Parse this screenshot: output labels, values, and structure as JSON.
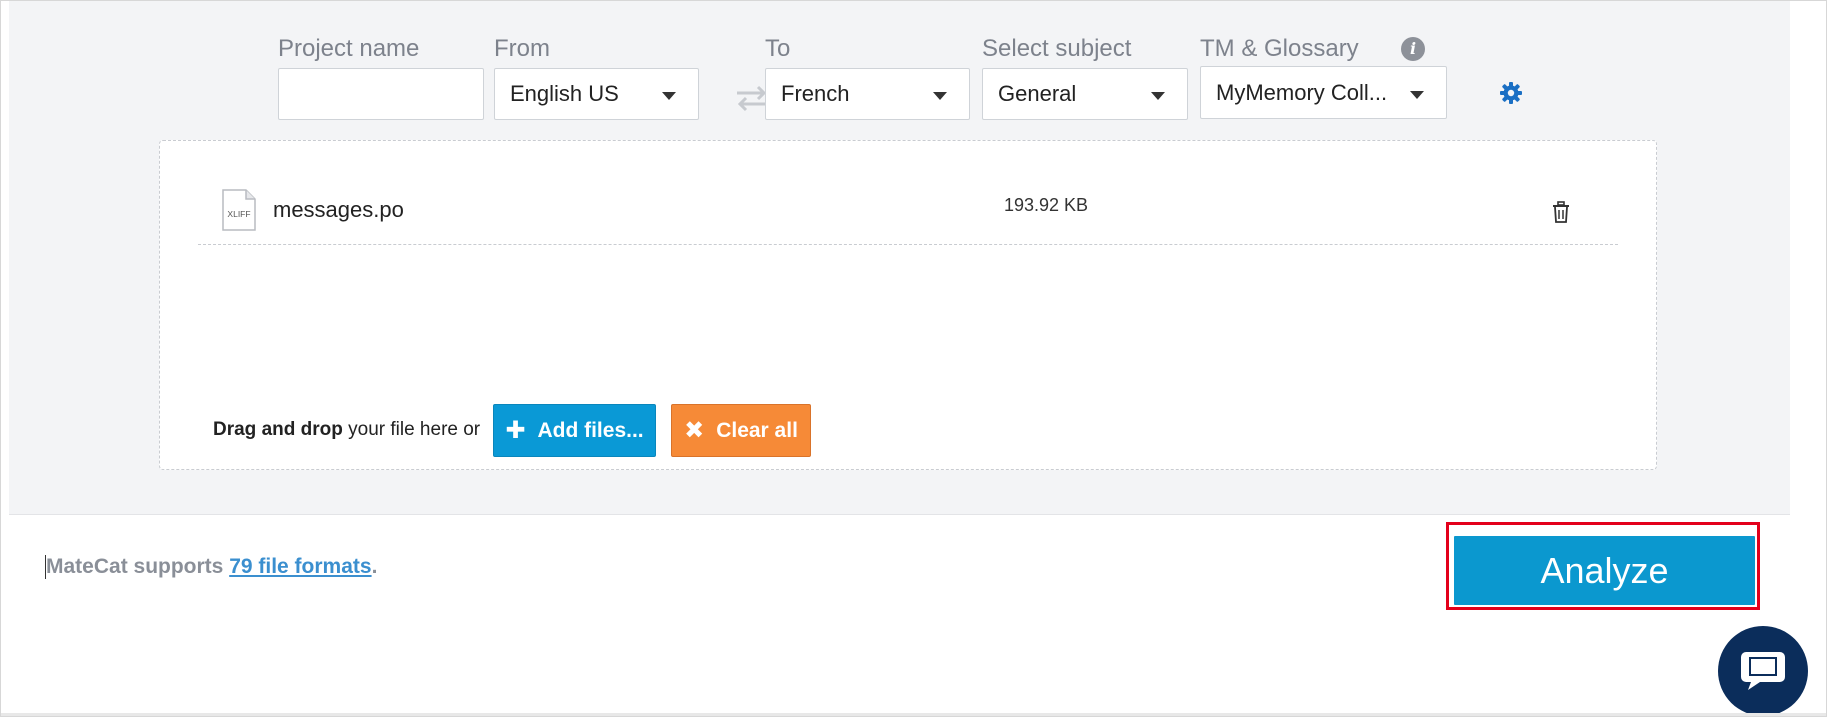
{
  "form": {
    "project_name_label": "Project name",
    "project_name_value": "",
    "from_label": "From",
    "from_value": "English US",
    "to_label": "To",
    "to_value": "French",
    "subject_label": "Select subject",
    "subject_value": "General",
    "tm_label": "TM & Glossary",
    "tm_value": "MyMemory Coll...",
    "info_icon": "i"
  },
  "files": [
    {
      "name": "messages.po",
      "size": "193.92 KB",
      "type_badge": "XLIFF"
    }
  ],
  "dropzone": {
    "drag_bold": "Drag and drop",
    "drag_rest": " your file here or",
    "add_files_label": "Add files...",
    "clear_all_label": "Clear all"
  },
  "footer": {
    "supports_prefix": "MateCat supports ",
    "supports_link": "79 file formats",
    "supports_suffix": "."
  },
  "analyze_label": "Analyze",
  "icons": {
    "swap": "swap-icon",
    "gear": "gear-icon",
    "trash": "trash-icon",
    "plus": "plus-icon",
    "close": "close-icon",
    "chat": "chat-icon"
  },
  "colors": {
    "accent_blue": "#0b98cf",
    "clear_orange": "#f68a37",
    "highlight_red": "#e3001b",
    "chat_navy": "#0b2d5b"
  }
}
